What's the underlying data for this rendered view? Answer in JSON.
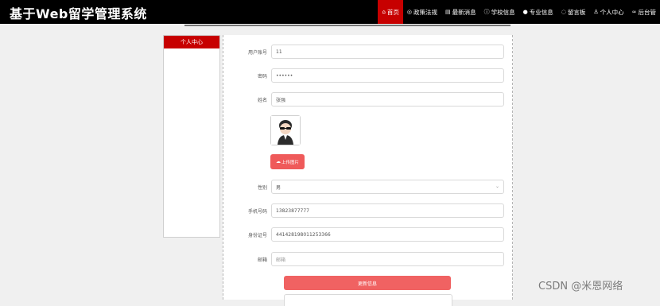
{
  "header": {
    "title": "基于Web留学管理系统",
    "nav": [
      {
        "icon": "home-icon",
        "label": "首页"
      },
      {
        "icon": "policy-icon",
        "label": "政策法规"
      },
      {
        "icon": "news-icon",
        "label": "最新消息"
      },
      {
        "icon": "school-icon",
        "label": "学校信息"
      },
      {
        "icon": "major-icon",
        "label": "专业信息"
      },
      {
        "icon": "message-board-icon",
        "label": "留言板"
      },
      {
        "icon": "user-icon",
        "label": "个人中心"
      },
      {
        "icon": "admin-link-icon",
        "label": "后台管"
      }
    ]
  },
  "sidebar": {
    "heading": "个人中心"
  },
  "form": {
    "username_label": "用户账号",
    "username_value": "11",
    "password_label": "密码",
    "password_value": "••••••",
    "name_label": "姓名",
    "name_value": "张强",
    "upload_label": "上传图片",
    "gender_label": "性别",
    "gender_value": "男",
    "phone_label": "手机号码",
    "phone_value": "13823877777",
    "idcard_label": "身份证号",
    "idcard_value": "441428198011253366",
    "email_label": "邮箱",
    "email_placeholder": "邮箱",
    "update_button": "更新信息"
  },
  "watermark": "CSDN @米恩网络"
}
